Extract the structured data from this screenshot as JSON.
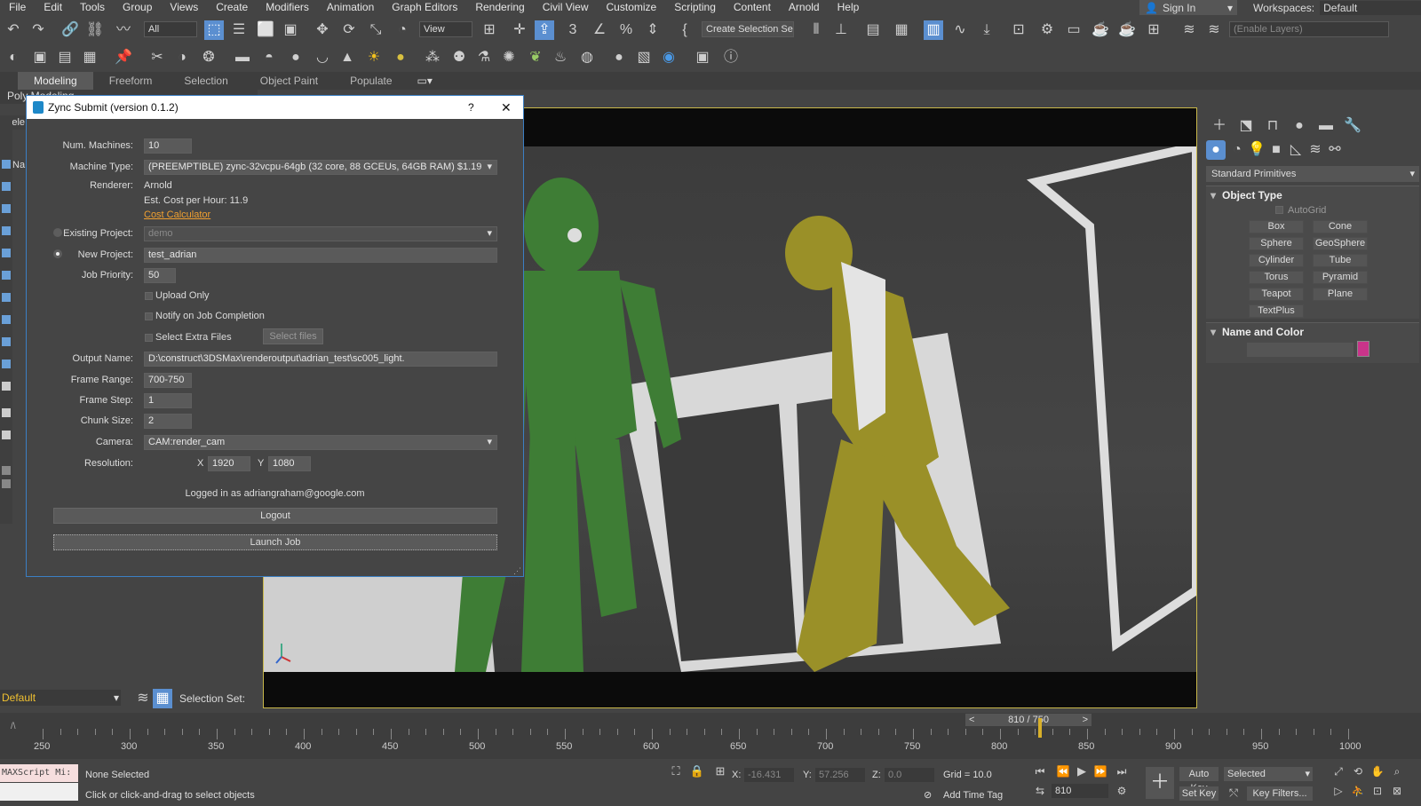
{
  "menu": [
    "File",
    "Edit",
    "Tools",
    "Group",
    "Views",
    "Create",
    "Modifiers",
    "Animation",
    "Graph Editors",
    "Rendering",
    "Civil View",
    "Customize",
    "Scripting",
    "Content",
    "Arnold",
    "Help"
  ],
  "signin": "Sign In",
  "workspaces": {
    "label": "Workspaces:",
    "value": "Default"
  },
  "toolbar": {
    "filter": "All",
    "view": "View",
    "create_selection": "Create Selection Se",
    "layers": "(Enable Layers)"
  },
  "ribbon": {
    "tabs": [
      "Modeling",
      "Freeform",
      "Selection",
      "Object Paint",
      "Populate"
    ],
    "sub": "Poly Modeling"
  },
  "viewport": {
    "left_label": "Sele",
    "nav_label": "Na"
  },
  "command_panel": {
    "category": "Standard Primitives",
    "object_type": {
      "title": "Object Type",
      "autogrid": "AutoGrid",
      "buttons": [
        "Box",
        "Cone",
        "Sphere",
        "GeoSphere",
        "Cylinder",
        "Tube",
        "Torus",
        "Pyramid",
        "Teapot",
        "Plane",
        "TextPlus"
      ]
    },
    "name_color": {
      "title": "Name and Color",
      "color": "#c9348a"
    }
  },
  "dialog": {
    "title": "Zync Submit (version 0.1.2)",
    "help": "?",
    "close": "✕",
    "num_machines": {
      "label": "Num. Machines:",
      "value": "10"
    },
    "machine_type": {
      "label": "Machine Type:",
      "value": "(PREEMPTIBLE) zync-32vcpu-64gb (32 core, 88 GCEUs, 64GB RAM) $1.19"
    },
    "renderer": {
      "label": "Renderer:",
      "value": "Arnold"
    },
    "est_cost": "Est. Cost per Hour: 11.9",
    "cost_calc": "Cost Calculator",
    "existing_project": {
      "label": "Existing Project:",
      "value": "demo"
    },
    "new_project": {
      "label": "New Project:",
      "value": "test_adrian"
    },
    "job_priority": {
      "label": "Job Priority:",
      "value": "50"
    },
    "upload_only": "Upload Only",
    "notify": "Notify on Job Completion",
    "extra_files": "Select Extra Files",
    "select_files": "Select files",
    "output_name": {
      "label": "Output Name:",
      "value": "D:\\construct\\3DSMax\\renderoutput\\adrian_test\\sc005_light."
    },
    "frame_range": {
      "label": "Frame Range:",
      "value": "700-750"
    },
    "frame_step": {
      "label": "Frame Step:",
      "value": "1"
    },
    "chunk_size": {
      "label": "Chunk Size:",
      "value": "2"
    },
    "camera": {
      "label": "Camera:",
      "value": "CAM:render_cam"
    },
    "resolution": {
      "label": "Resolution:",
      "x_label": "X",
      "x": "1920",
      "y_label": "Y",
      "y": "1080"
    },
    "logged_in": "Logged in as adriangraham@google.com",
    "logout": "Logout",
    "launch": "Launch Job"
  },
  "bottom_left": {
    "layer": "Default",
    "selection_set": "Selection Set:"
  },
  "timeline": {
    "frame": "810 / 750",
    "prev": "<",
    "next": ">",
    "ticks": [
      "250",
      "300",
      "350",
      "400",
      "450",
      "500",
      "550",
      "600",
      "650",
      "700",
      "750",
      "800",
      "850",
      "900",
      "950",
      "1000"
    ]
  },
  "status": {
    "script": "MAXScript Mi:",
    "selected": "None Selected",
    "prompt": "Click or click-and-drag to select objects",
    "x_label": "X:",
    "x": "-16.431",
    "y_label": "Y:",
    "y": "57.256",
    "z_label": "Z:",
    "z": "0.0",
    "grid": "Grid = 10.0",
    "add_time_tag": "Add Time Tag",
    "auto_key": "Auto Key",
    "set_key": "Set Key",
    "selected_mode": "Selected",
    "key_filters": "Key Filters...",
    "frame": "810"
  }
}
